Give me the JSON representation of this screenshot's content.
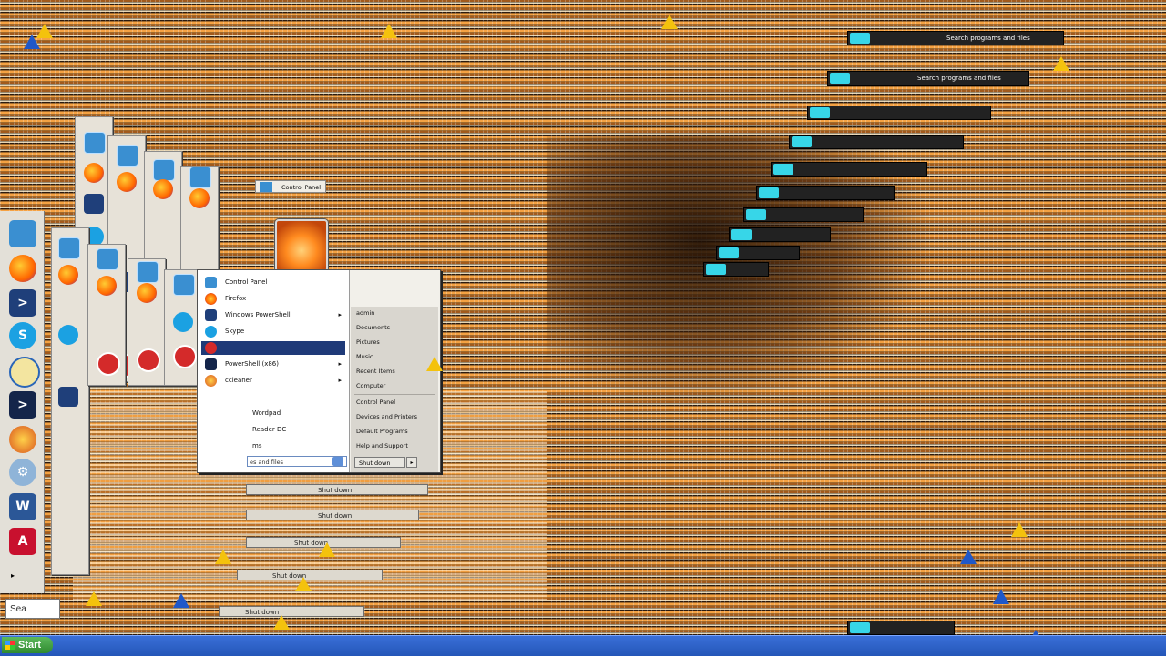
{
  "start_menu": {
    "left_items": [
      {
        "label": "Control Panel",
        "icon": "control-panel-icon",
        "arrow": ""
      },
      {
        "label": "Firefox",
        "icon": "firefox-icon",
        "arrow": ""
      },
      {
        "label": "Windows PowerShell",
        "icon": "powershell-icon",
        "arrow": "▸"
      },
      {
        "label": "Skype",
        "icon": "skype-icon",
        "arrow": ""
      },
      {
        "label": "",
        "icon": "error-icon",
        "arrow": "",
        "selected": true
      },
      {
        "label": "PowerShell (x86)",
        "icon": "powershell-icon",
        "arrow": "▸"
      },
      {
        "label": "ccleaner",
        "icon": "ccleaner-icon",
        "arrow": "▸"
      },
      {
        "label": "Wordpad",
        "icon": "wordpad-icon",
        "arrow": ""
      },
      {
        "label": "Reader DC",
        "icon": "acrobat-icon",
        "arrow": ""
      },
      {
        "label": "ms",
        "icon": "",
        "arrow": ""
      }
    ],
    "right_items": [
      "admin",
      "Documents",
      "Pictures",
      "Music",
      "Recent Items",
      "Computer",
      "Control Panel",
      "Devices and Printers",
      "Default Programs",
      "Help and Support"
    ],
    "search_placeholder": "es and files",
    "shutdown_label": "Shut down",
    "shutdown_arrow": "▸"
  },
  "control_panel_ghost_label": "Control Panel",
  "search_ghost_text": "Search programs and files",
  "desktop_search_label": "Sea",
  "ghost_shutdown_label": "Shut down",
  "taskbar": {
    "start_label": "Start"
  },
  "colors": {
    "desktop_orange": "#f5a243",
    "selection_blue": "#1f3a78",
    "taskbar_blue": "#2456b8",
    "warning_yellow": "#f4c20d"
  }
}
